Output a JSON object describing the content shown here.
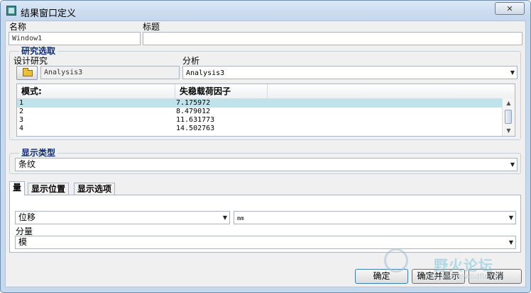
{
  "window": {
    "title": "结果窗口定义",
    "close_glyph": "✕"
  },
  "name": {
    "label": "名称",
    "value": "Window1"
  },
  "heading": {
    "label": "标题",
    "value": ""
  },
  "study_group": {
    "title": "研究选取",
    "design_study": {
      "label": "设计研究",
      "value": "Analysis3",
      "open_icon": "folder-open-icon"
    },
    "analysis": {
      "label": "分析",
      "value": "Analysis3"
    },
    "table": {
      "columns": [
        "模式:",
        "失稳载荷因子"
      ],
      "rows": [
        {
          "mode": "1",
          "factor": "7.175972",
          "selected": true
        },
        {
          "mode": "2",
          "factor": "8.479012"
        },
        {
          "mode": "3",
          "factor": "11.631773"
        },
        {
          "mode": "4",
          "factor": "14.502763"
        }
      ]
    }
  },
  "display_type": {
    "title": "显示类型",
    "value": "条纹"
  },
  "tabs": [
    {
      "label": "量",
      "active": true
    },
    {
      "label": "显示位置"
    },
    {
      "label": "显示选项"
    }
  ],
  "quantity": {
    "value": "位移",
    "unit": "mm",
    "component_label": "分量",
    "component": "模"
  },
  "buttons": {
    "ok": "确定",
    "ok_show": "确定并显示",
    "cancel": "取消"
  },
  "watermark": {
    "title": "野火论坛",
    "sub": "www.proewildfire.cn"
  },
  "colors": {
    "selection": "#bfe3ea",
    "group_title": "#0d2c6c"
  }
}
